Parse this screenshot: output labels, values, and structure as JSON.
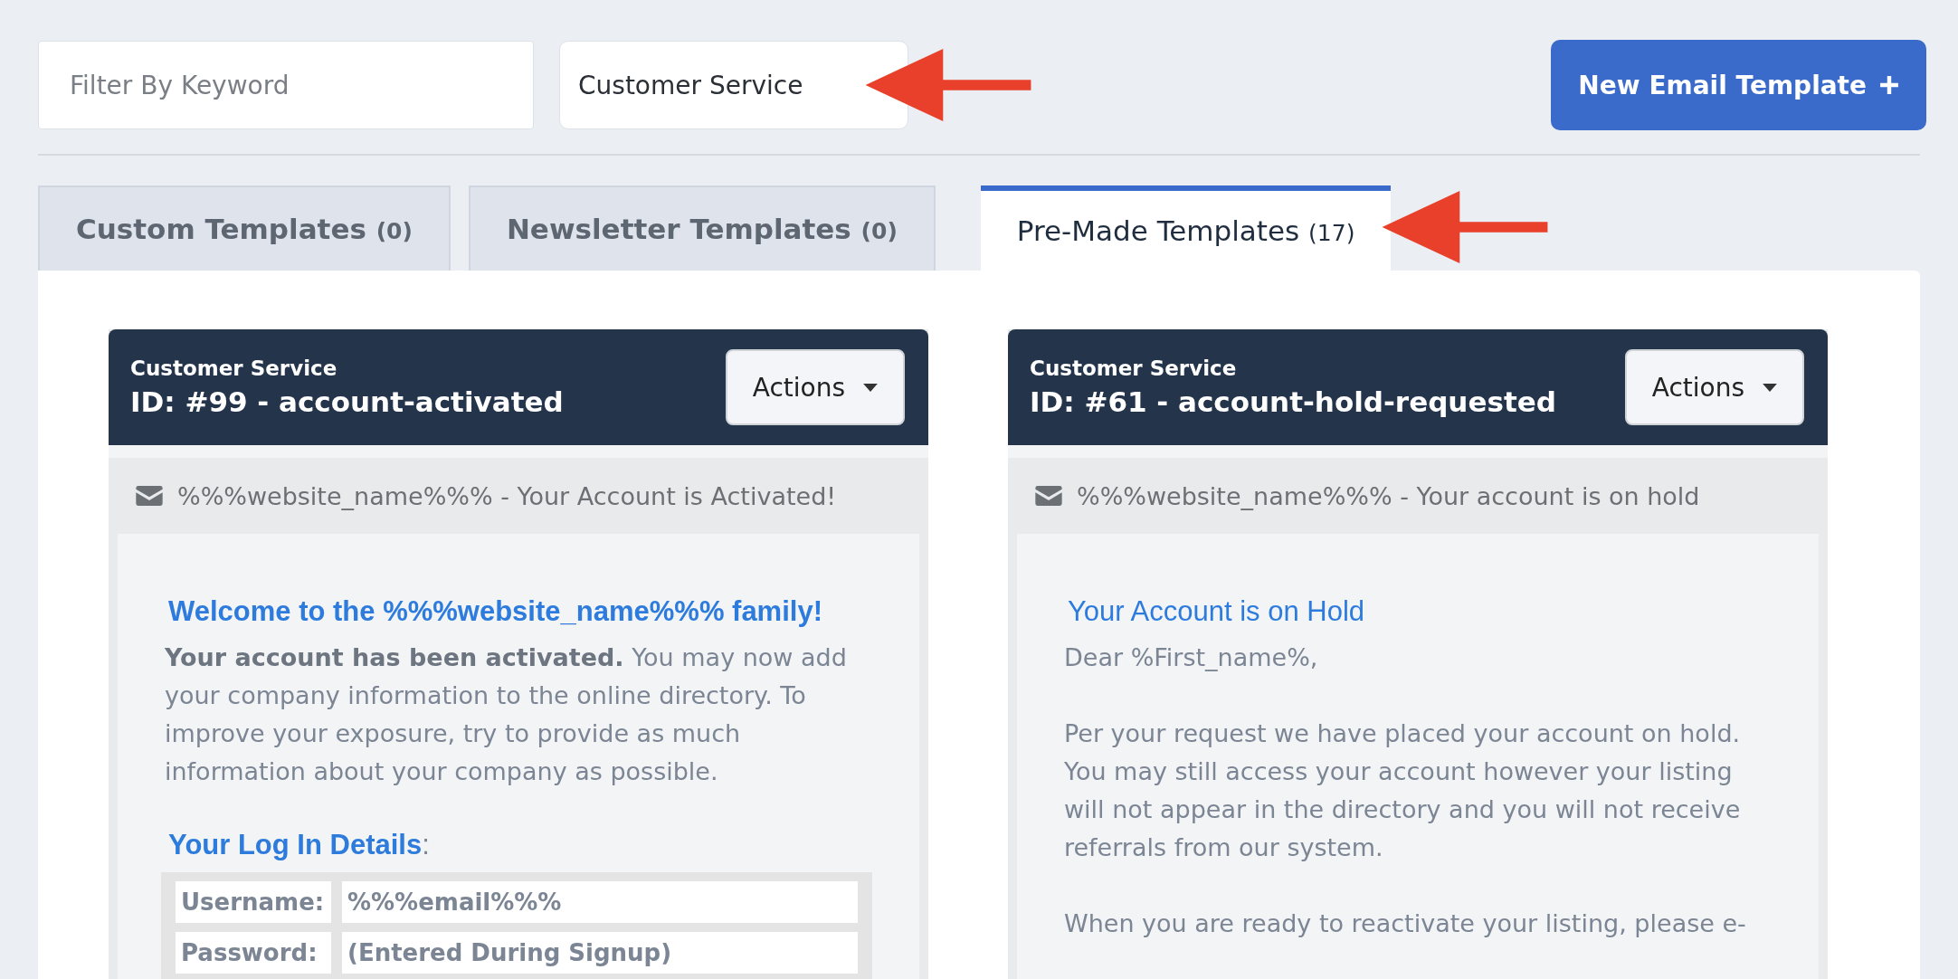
{
  "filter": {
    "placeholder": "Filter By Keyword"
  },
  "category_select": {
    "value": "Customer Service"
  },
  "new_template_button": {
    "label": "New Email Template"
  },
  "tabs": [
    {
      "label": "Custom Templates",
      "count": "(0)",
      "selected": false
    },
    {
      "label": "Newsletter Templates",
      "count": "(0)",
      "selected": false
    },
    {
      "label": "Pre-Made Templates",
      "count": "(17)",
      "selected": true
    }
  ],
  "templates": [
    {
      "category": "Customer Service",
      "title": "ID: #99 - account-activated",
      "actions": "Actions",
      "subject": "%%%website_name%%% - Your Account is Activated!",
      "body": [
        {
          "kind": "heading",
          "bold": true,
          "text": "Welcome to the %%%website_name%%% family!"
        },
        {
          "kind": "paragraph",
          "text": "**Your account has been activated.** You may now add your company information to the online directory. To improve your exposure, try to provide as much information about your company as possible."
        },
        {
          "kind": "heading",
          "bold": true,
          "text": "Your Log In Details",
          "suffix": ":"
        },
        {
          "kind": "table",
          "rows": [
            [
              "Username:",
              "%%%email%%%"
            ],
            [
              "Password:",
              "(Entered During Signup)"
            ]
          ]
        }
      ]
    },
    {
      "category": "Customer Service",
      "title": "ID: #61 - account-hold-requested",
      "actions": "Actions",
      "subject": "%%%website_name%%% - Your account is on hold",
      "body": [
        {
          "kind": "heading",
          "bold": false,
          "text": "Your Account is on Hold"
        },
        {
          "kind": "paragraph",
          "text": "Dear %First_name%,"
        },
        {
          "kind": "paragraph",
          "text": "Per your request we have placed your account on hold. You may still access your account however your listing will not appear in the directory and you will not receive referrals from our system."
        },
        {
          "kind": "paragraph",
          "text": "When you are ready to reactivate your listing, please e-"
        }
      ]
    }
  ]
}
